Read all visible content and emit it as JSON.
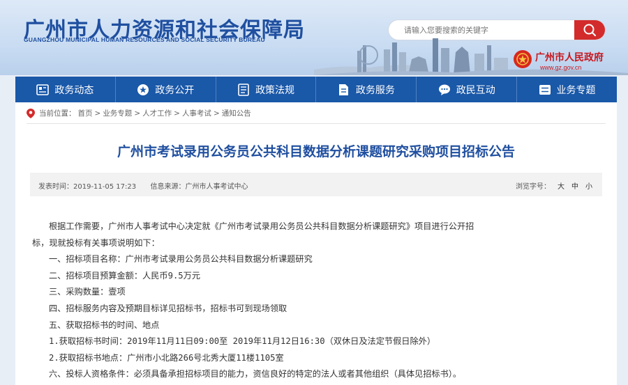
{
  "header": {
    "title": "广州市人力资源和社会保障局",
    "subtitle": "GUANGZHOU MUNICIPAL HUMAN RESOURCES AND SOCIAL SECURITY BUREAU",
    "search_placeholder": "请输入您要搜索的关键字",
    "gov_name": "广州市人民政府",
    "gov_url": "www.gz.gov.cn"
  },
  "nav": {
    "items": [
      {
        "label": "政务动态",
        "icon": "news-icon"
      },
      {
        "label": "政务公开",
        "icon": "star-icon"
      },
      {
        "label": "政策法规",
        "icon": "document-icon"
      },
      {
        "label": "政务服务",
        "icon": "service-icon"
      },
      {
        "label": "政民互动",
        "icon": "chat-icon"
      },
      {
        "label": "业务专题",
        "icon": "list-icon"
      }
    ]
  },
  "breadcrumb": {
    "prefix": "当前位置：",
    "items": [
      "首页",
      "业务专题",
      "人才工作",
      "人事考试",
      "通知公告"
    ],
    "separator": " > "
  },
  "article": {
    "title": "广州市考试录用公务员公共科目数据分析课题研究采购项目招标公告",
    "publish_time": "发表时间：2019-11-05 17:23",
    "source": "信息来源：广州市人事考试中心",
    "font_size_label": "浏览字号：",
    "size_large": "大",
    "size_medium": "中",
    "size_small": "小",
    "paragraphs": [
      "根据工作需要，广州市人事考试中心决定就《广州市考试录用公务员公共科目数据分析课题研究》项目进行公开招",
      "标，现就投标有关事项说明如下：",
      "一、招标项目名称：广州市考试录用公务员公共科目数据分析课题研究",
      "二、招标项目预算金额：人民币9.5万元",
      "三、采购数量：壹项",
      "四、招标服务内容及预期目标详见招标书，招标书可到现场领取",
      "五、获取招标书的时间、地点",
      "1.获取招标书时间：2019年11月11日09:00至 2019年11月12日16:30（双休日及法定节假日除外）",
      "2.获取招标书地点：广州市小北路266号北秀大厦11楼1105室",
      "六、投标人资格条件：必须具备承担招标项目的能力，资信良好的特定的法人或者其他组织（具体见招标书）。"
    ]
  },
  "colors": {
    "brand_blue": "#1a58a8",
    "title_blue": "#1f4fa0",
    "search_red": "#d32b2b",
    "gov_red": "#c8171d"
  }
}
